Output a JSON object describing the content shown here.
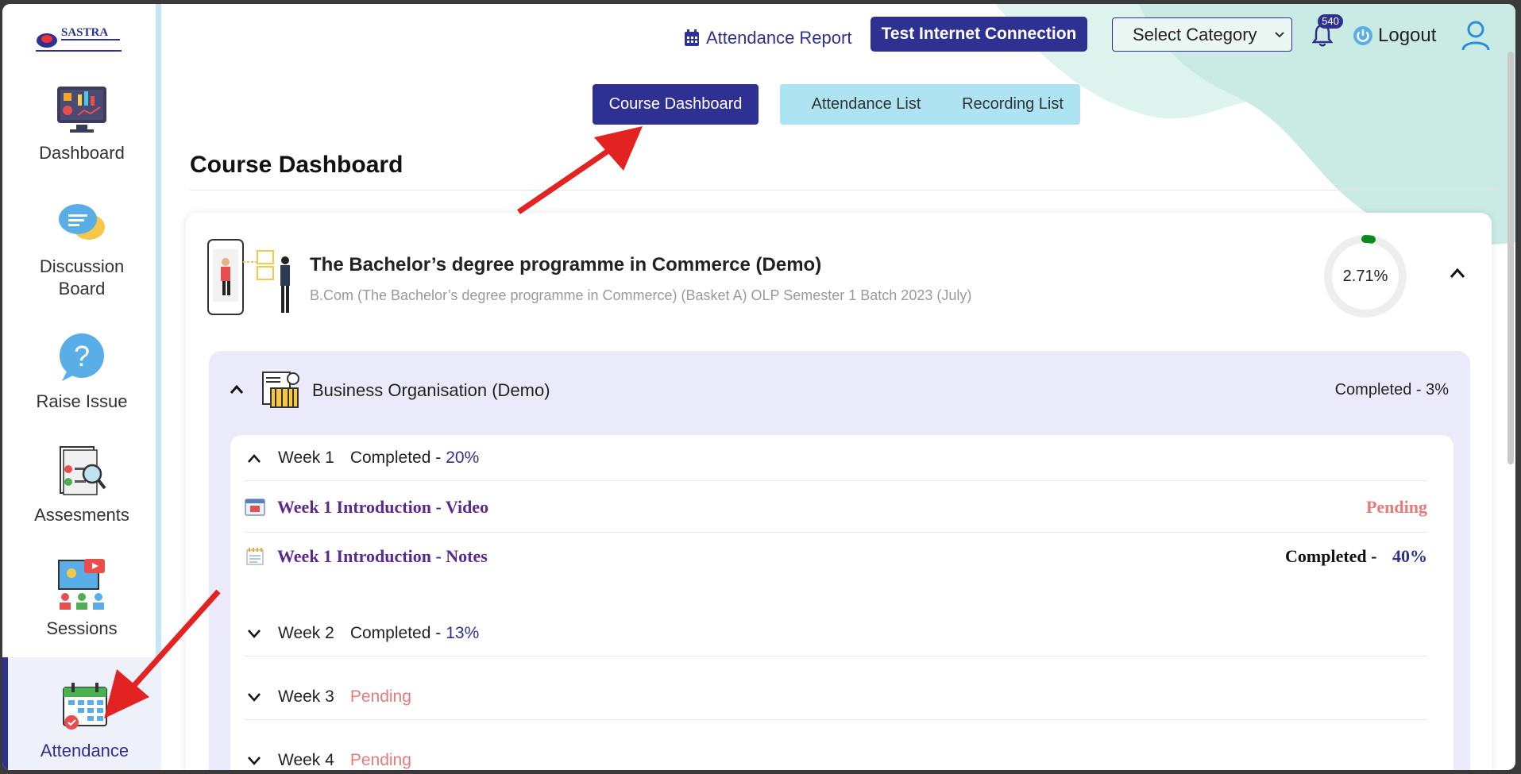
{
  "brand": {
    "logo_text": "SASTRA"
  },
  "sidebar": {
    "items": [
      {
        "label": "Dashboard",
        "icon": "dashboard-icon"
      },
      {
        "label": "Discussion Board",
        "icon": "chat-bubbles-icon"
      },
      {
        "label": "Raise Issue",
        "icon": "question-bubble-icon"
      },
      {
        "label": "Assesments",
        "icon": "assessment-icon"
      },
      {
        "label": "Sessions",
        "icon": "sessions-icon"
      },
      {
        "label": "Attendance",
        "icon": "calendar-icon",
        "active": true
      }
    ]
  },
  "header": {
    "attendance_report": "Attendance Report",
    "test_connection": "Test Internet Connection",
    "select_category": "Select Category",
    "notification_count": "540",
    "logout": "Logout"
  },
  "tabs": {
    "course_dashboard": "Course Dashboard",
    "attendance_list": "Attendance List",
    "recording_list": "Recording List"
  },
  "page_title": "Course Dashboard",
  "programme": {
    "title": "The Bachelor’s degree programme in Commerce (Demo)",
    "subtitle": "B.Com (The Bachelor’s degree programme in Commerce) (Basket A) OLP Semester 1 Batch 2023 (July)",
    "progress_text": "2.71%",
    "progress_fraction": 0.0271
  },
  "subject": {
    "title": "Business Organisation (Demo)",
    "status": "Completed - 3%"
  },
  "weeks": [
    {
      "label": "Week 1",
      "status_label": "Completed -",
      "percent": "20%",
      "expanded": true
    },
    {
      "label": "Week 2",
      "status_label": "Completed -",
      "percent": "13%",
      "expanded": false
    },
    {
      "label": "Week 3",
      "status": "Pending",
      "expanded": false
    },
    {
      "label": "Week 4",
      "status": "Pending",
      "expanded": false
    }
  ],
  "week1_items": [
    {
      "title": "Week 1 Introduction - Video",
      "status": "Pending"
    },
    {
      "title": "Week 1 Introduction - Notes",
      "status_label": "Completed -",
      "percent": "40%"
    }
  ],
  "colors": {
    "primary": "#2e3192",
    "tab_light": "#aee3f2",
    "pending": "#e77b7b",
    "item_title": "#5b2a8f",
    "subject_bg": "#ebeafb",
    "progress": "#0b8a1e",
    "annotation_arrow": "#e32222"
  }
}
